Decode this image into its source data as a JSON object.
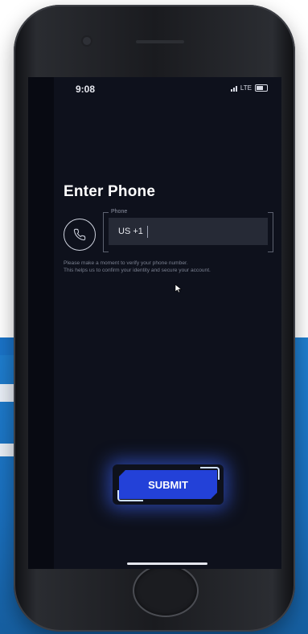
{
  "status": {
    "time": "9:08",
    "network": "LTE"
  },
  "screen": {
    "title": "Enter Phone",
    "phone_field": {
      "label": "Phone",
      "value": "US +1"
    },
    "helper_line_1": "Please make a moment to verify your phone number.",
    "helper_line_2": "This helps us to confirm your identity and secure your account.",
    "submit_label": "SUBMIT"
  },
  "colors": {
    "accent": "#2341d8",
    "screen_bg": "#0e111c",
    "input_bg": "#262a36"
  },
  "icons": {
    "phone": "phone-icon",
    "cursor": "cursor-icon",
    "signal": "signal-icon",
    "battery": "battery-icon"
  }
}
